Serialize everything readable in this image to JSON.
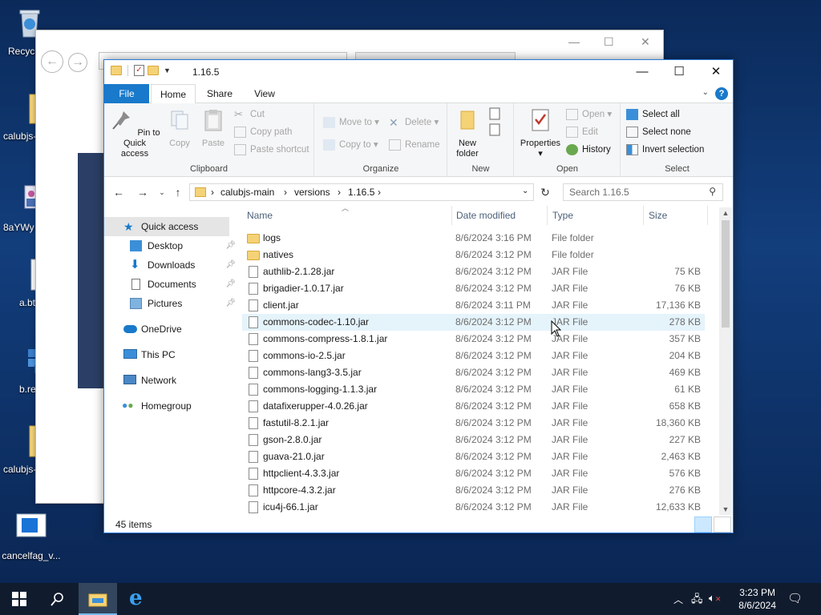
{
  "desktop": {
    "icons": [
      {
        "label": "Recycl"
      },
      {
        "label": "calubjs-"
      },
      {
        "label": "8aYWy"
      },
      {
        "label": "a.bt"
      },
      {
        "label": "b.re"
      },
      {
        "label": "calubjs-"
      },
      {
        "label": "cancelfag_v..."
      }
    ]
  },
  "explorer": {
    "title": "1.16.5",
    "tabs": {
      "file": "File",
      "home": "Home",
      "share": "Share",
      "view": "View"
    },
    "ribbon": {
      "clipboard": {
        "label": "Clipboard",
        "pin": "Pin to Quick\naccess",
        "copy": "Copy",
        "paste": "Paste",
        "cut": "Cut",
        "copy_path": "Copy path",
        "paste_shortcut": "Paste shortcut"
      },
      "organize": {
        "label": "Organize",
        "move_to": "Move to",
        "copy_to": "Copy to",
        "delete": "Delete",
        "rename": "Rename"
      },
      "new": {
        "label": "New",
        "new_folder": "New\nfolder"
      },
      "open": {
        "label": "Open",
        "properties": "Properties",
        "open": "Open",
        "edit": "Edit",
        "history": "History"
      },
      "select": {
        "label": "Select",
        "select_all": "Select all",
        "select_none": "Select none",
        "invert": "Invert selection"
      }
    },
    "address": {
      "crumbs": [
        "calubjs-main",
        "versions",
        "1.16.5"
      ],
      "search_placeholder": "Search 1.16.5"
    },
    "nav": {
      "quick_access": "Quick access",
      "desktop": "Desktop",
      "downloads": "Downloads",
      "documents": "Documents",
      "pictures": "Pictures",
      "onedrive": "OneDrive",
      "this_pc": "This PC",
      "network": "Network",
      "homegroup": "Homegroup"
    },
    "columns": {
      "name": "Name",
      "date": "Date modified",
      "type": "Type",
      "size": "Size"
    },
    "files": [
      {
        "name": "logs",
        "date": "8/6/2024 3:16 PM",
        "type": "File folder",
        "size": ""
      },
      {
        "name": "natives",
        "date": "8/6/2024 3:12 PM",
        "type": "File folder",
        "size": ""
      },
      {
        "name": "authlib-2.1.28.jar",
        "date": "8/6/2024 3:12 PM",
        "type": "JAR File",
        "size": "75 KB"
      },
      {
        "name": "brigadier-1.0.17.jar",
        "date": "8/6/2024 3:12 PM",
        "type": "JAR File",
        "size": "76 KB"
      },
      {
        "name": "client.jar",
        "date": "8/6/2024 3:11 PM",
        "type": "JAR File",
        "size": "17,136 KB"
      },
      {
        "name": "commons-codec-1.10.jar",
        "date": "8/6/2024 3:12 PM",
        "type": "JAR File",
        "size": "278 KB"
      },
      {
        "name": "commons-compress-1.8.1.jar",
        "date": "8/6/2024 3:12 PM",
        "type": "JAR File",
        "size": "357 KB"
      },
      {
        "name": "commons-io-2.5.jar",
        "date": "8/6/2024 3:12 PM",
        "type": "JAR File",
        "size": "204 KB"
      },
      {
        "name": "commons-lang3-3.5.jar",
        "date": "8/6/2024 3:12 PM",
        "type": "JAR File",
        "size": "469 KB"
      },
      {
        "name": "commons-logging-1.1.3.jar",
        "date": "8/6/2024 3:12 PM",
        "type": "JAR File",
        "size": "61 KB"
      },
      {
        "name": "datafixerupper-4.0.26.jar",
        "date": "8/6/2024 3:12 PM",
        "type": "JAR File",
        "size": "658 KB"
      },
      {
        "name": "fastutil-8.2.1.jar",
        "date": "8/6/2024 3:12 PM",
        "type": "JAR File",
        "size": "18,360 KB"
      },
      {
        "name": "gson-2.8.0.jar",
        "date": "8/6/2024 3:12 PM",
        "type": "JAR File",
        "size": "227 KB"
      },
      {
        "name": "guava-21.0.jar",
        "date": "8/6/2024 3:12 PM",
        "type": "JAR File",
        "size": "2,463 KB"
      },
      {
        "name": "httpclient-4.3.3.jar",
        "date": "8/6/2024 3:12 PM",
        "type": "JAR File",
        "size": "576 KB"
      },
      {
        "name": "httpcore-4.3.2.jar",
        "date": "8/6/2024 3:12 PM",
        "type": "JAR File",
        "size": "276 KB"
      },
      {
        "name": "icu4j-66.1.jar",
        "date": "8/6/2024 3:12 PM",
        "type": "JAR File",
        "size": "12,633 KB"
      }
    ],
    "status": {
      "item_count": "45 items"
    }
  },
  "taskbar": {
    "time": "3:23 PM",
    "date": "8/6/2024"
  },
  "colors": {
    "accent": "#1979ca",
    "hover_row": "#e5f3fb",
    "folder": "#f5d276"
  }
}
